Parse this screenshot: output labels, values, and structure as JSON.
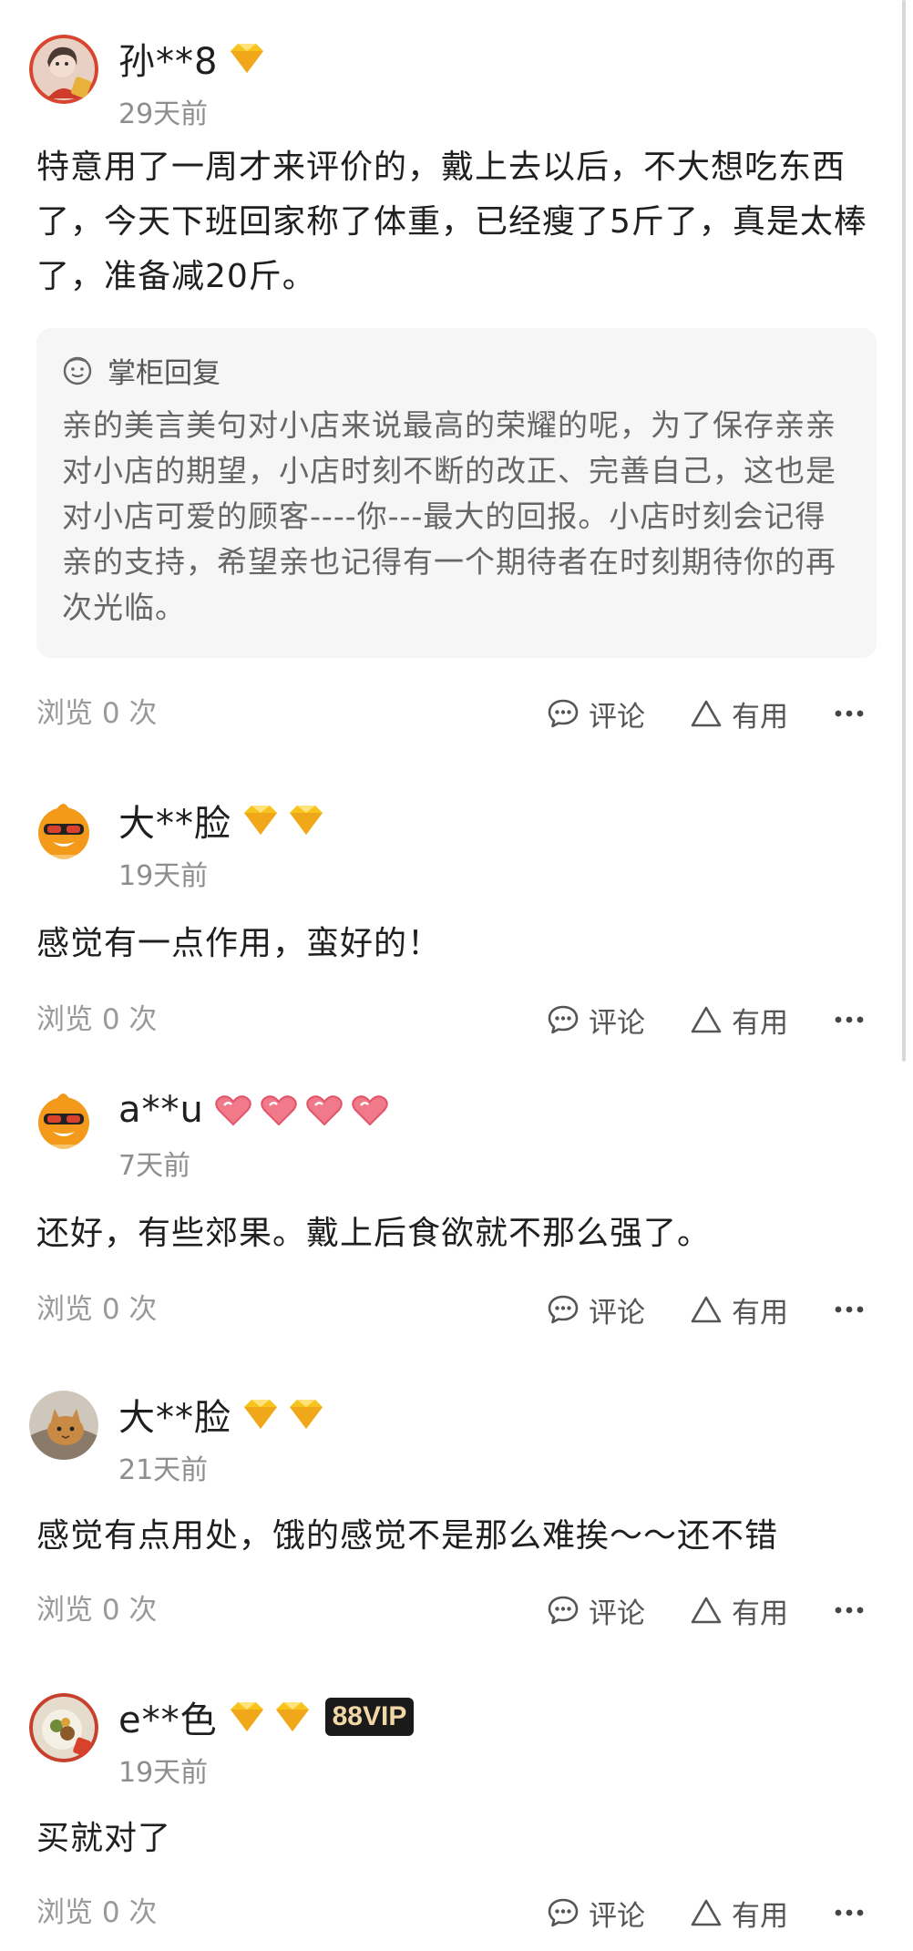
{
  "colors": {
    "text": "#1f1f1f",
    "muted": "#8e8e8e",
    "reply_bg": "#f6f6f6",
    "vip_bg": "#1a1a1a",
    "vip_fg": "#f2d7a6"
  },
  "actions": {
    "comment": "评论",
    "useful": "有用"
  },
  "reviews": [
    {
      "user": "孙**8",
      "avatar_icon": "girl-photo-avatar",
      "badge_icon": "diamond-icon",
      "badge_count": 1,
      "time": "29天前",
      "text": "特意用了一周才来评价的，戴上去以后，不大想吃东西了，今天下班回家称了体重，已经瘦了5斤了，真是太棒了，准备减20斤。",
      "reply": {
        "title": "掌柜回复",
        "text": "亲的美言美句对小店来说最高的荣耀的呢，为了保存亲亲对小店的期望，小店时刻不断的改正、完善自己，这也是对小店可爱的顾客----你---最大的回报。小店时刻会记得亲的支持，希望亲也记得有一个期待者在时刻期待你的再次光临。"
      },
      "views": "浏览 0 次"
    },
    {
      "user": "大**脸",
      "avatar_icon": "orange-cartoon-avatar",
      "badge_icon": "diamond-icon",
      "badge_count": 2,
      "time": "19天前",
      "text": "感觉有一点作用，蛮好的！",
      "views": "浏览 0 次"
    },
    {
      "user": "a**u",
      "avatar_icon": "orange-cartoon-avatar",
      "badge_icon": "heart-icon",
      "badge_count": 4,
      "time": "7天前",
      "text": "还好，有些郊果。戴上后食欲就不那么强了。",
      "views": "浏览 0 次"
    },
    {
      "user": "大**脸",
      "avatar_icon": "cat-photo-avatar",
      "badge_icon": "diamond-icon",
      "badge_count": 2,
      "time": "21天前",
      "text": "感觉有点用处，饿的感觉不是那么难挨～～还不错",
      "views": "浏览 0 次"
    },
    {
      "user": "e**色",
      "avatar_icon": "food-photo-avatar",
      "badge_icon": "diamond-icon",
      "badge_count": 2,
      "vip": "88VIP",
      "time": "19天前",
      "text": "买就对了",
      "views": "浏览 0 次"
    }
  ]
}
